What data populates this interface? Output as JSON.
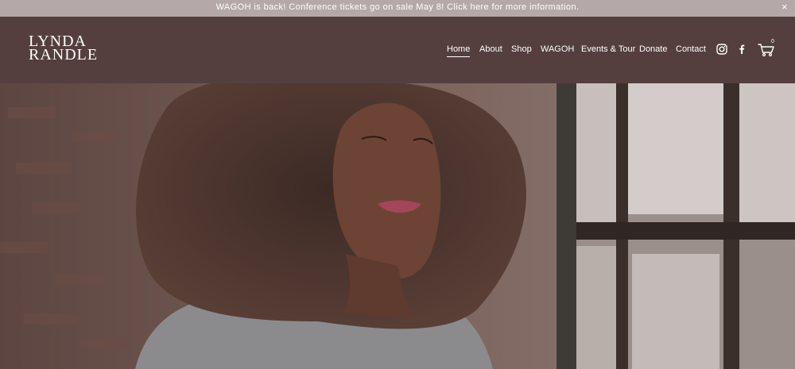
{
  "announcement": {
    "text": "WAGOH is back! Conference tickets go on sale May 8! Click here for more information.",
    "close_label": "×"
  },
  "brand": {
    "line1": "LYNDA",
    "line2": "RANDLE"
  },
  "nav": {
    "items": [
      {
        "label": "Home",
        "active": true
      },
      {
        "label": "About"
      },
      {
        "label": "Shop"
      },
      {
        "label": "WAGOH"
      },
      {
        "label": "Events & Tour"
      },
      {
        "label": "Donate"
      },
      {
        "label": "Contact"
      }
    ]
  },
  "social": {
    "icons": [
      "instagram-icon",
      "facebook-icon"
    ]
  },
  "cart": {
    "icon": "cart-icon",
    "count": "0"
  },
  "colors": {
    "announcement_bg": "#b4a9a8",
    "header_bg": "#553f3e",
    "text": "#ffffff"
  }
}
